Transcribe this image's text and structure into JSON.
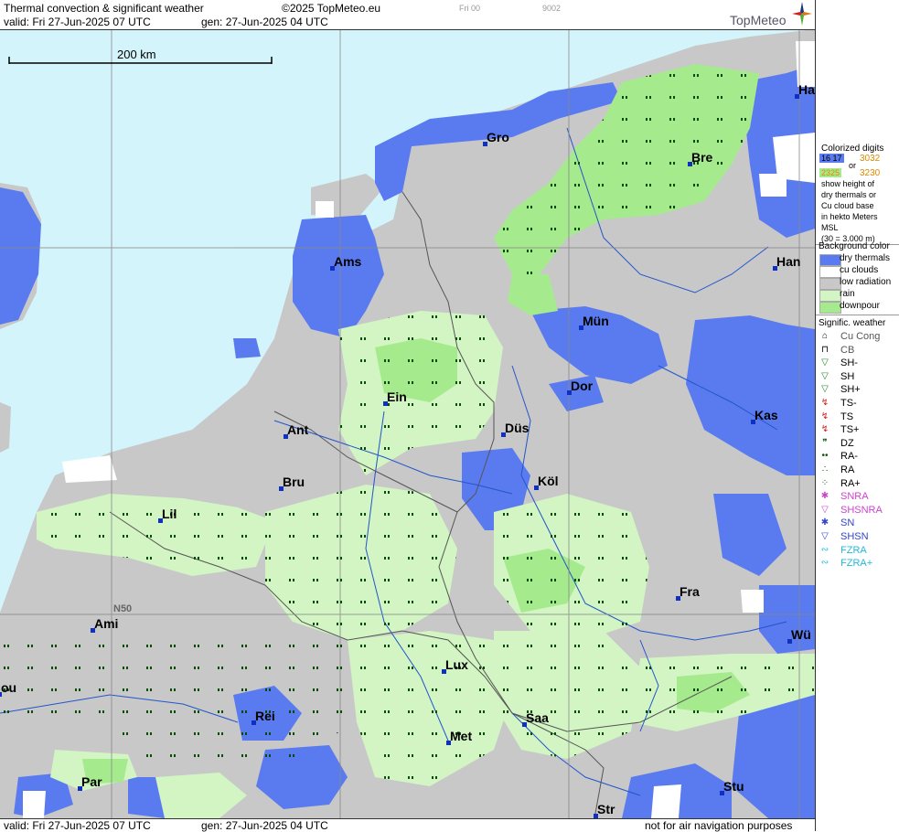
{
  "header": {
    "title": "Thermal convection & significant weather",
    "copyright": "©2025 TopMeteo.eu",
    "model_run_label": "Fri 00",
    "code": "9002",
    "valid": "valid:  Fri  27-Jun-2025  07 UTC",
    "gen": "gen: 27-Jun-2025  04 UTC",
    "brand": "TopMeteo"
  },
  "scale": {
    "label": "200 km"
  },
  "grid_label": "N50",
  "cities": [
    {
      "name": "Gro"
    },
    {
      "name": "Bre"
    },
    {
      "name": "Ha"
    },
    {
      "name": "Ams"
    },
    {
      "name": "Han"
    },
    {
      "name": "Mün"
    },
    {
      "name": "Dor"
    },
    {
      "name": "Ein"
    },
    {
      "name": "Kas"
    },
    {
      "name": "Ant"
    },
    {
      "name": "Düs"
    },
    {
      "name": "Bru"
    },
    {
      "name": "Köl"
    },
    {
      "name": "Lil"
    },
    {
      "name": "Fra"
    },
    {
      "name": "Ami"
    },
    {
      "name": "Wü"
    },
    {
      "name": "Lux"
    },
    {
      "name": "ou"
    },
    {
      "name": "Rei"
    },
    {
      "name": "Saa"
    },
    {
      "name": "Met"
    },
    {
      "name": "Par"
    },
    {
      "name": "Stu"
    },
    {
      "name": "Str"
    }
  ],
  "legend": {
    "digits_title": "Colorized digits",
    "digits_a": "16 17",
    "digits_b": "3032",
    "or": "or",
    "digits_c": "2325",
    "digits_d": "3230",
    "desc1": "show height of",
    "desc2": "dry thermals or",
    "desc3": "Cu cloud base",
    "desc4": "in hekto Meters",
    "desc5": "MSL",
    "desc6": "(30 = 3.000 m)",
    "bg_title": "Background color",
    "bg_items": [
      {
        "label": "dry thermals",
        "color": "#5a7bf0"
      },
      {
        "label": "cu clouds",
        "color": "#ffffff"
      },
      {
        "label": "low radiation",
        "color": "#c8c8c8"
      },
      {
        "label": "rain",
        "color": "#d2f5c3"
      },
      {
        "label": "downpour",
        "color": "#a6ea8e"
      }
    ],
    "wx_title": "Signific. weather",
    "wx_items": [
      {
        "label": "Cu Cong",
        "icon": "cu-cong-icon",
        "color": "#000000"
      },
      {
        "label": "CB",
        "icon": "cb-icon",
        "color": "#000000"
      },
      {
        "label": "SH-",
        "icon": "shower-light-icon",
        "color": "#228822"
      },
      {
        "label": "SH",
        "icon": "shower-icon",
        "color": "#228822"
      },
      {
        "label": "SH+",
        "icon": "shower-heavy-icon",
        "color": "#228822"
      },
      {
        "label": "TS-",
        "icon": "thunderstorm-light-icon",
        "color": "#cc2222"
      },
      {
        "label": "TS",
        "icon": "thunderstorm-icon",
        "color": "#cc2222"
      },
      {
        "label": "TS+",
        "icon": "thunderstorm-heavy-icon",
        "color": "#cc2222"
      },
      {
        "label": "DZ",
        "icon": "drizzle-icon",
        "color": "#115511"
      },
      {
        "label": "RA-",
        "icon": "rain-light-icon",
        "color": "#115511"
      },
      {
        "label": "RA",
        "icon": "rain-icon",
        "color": "#115511"
      },
      {
        "label": "RA+",
        "icon": "rain-heavy-icon",
        "color": "#115511"
      },
      {
        "label": "SNRA",
        "icon": "snow-rain-icon",
        "color": "#cc44cc"
      },
      {
        "label": "SHSNRA",
        "icon": "snow-rain-shower-icon",
        "color": "#cc44cc"
      },
      {
        "label": "SN",
        "icon": "snow-icon",
        "color": "#3344cc"
      },
      {
        "label": "SHSN",
        "icon": "snow-shower-icon",
        "color": "#3344cc"
      },
      {
        "label": "FZRA",
        "icon": "freezing-rain-icon",
        "color": "#22bbdd"
      },
      {
        "label": "FZRA+",
        "icon": "freezing-rain-heavy-icon",
        "color": "#22bbdd"
      }
    ]
  },
  "footer": {
    "valid": "valid:  Fri  27-Jun-2025  07 UTC",
    "gen": "gen: 27-Jun-2025  04 UTC",
    "note": "not for air navigation purposes"
  },
  "colors": {
    "sea": "#d4f4fb",
    "dry": "#5a7bf0",
    "low": "#c8c8c8",
    "rain": "#d2f5c3",
    "downpour": "#a6ea8e"
  }
}
